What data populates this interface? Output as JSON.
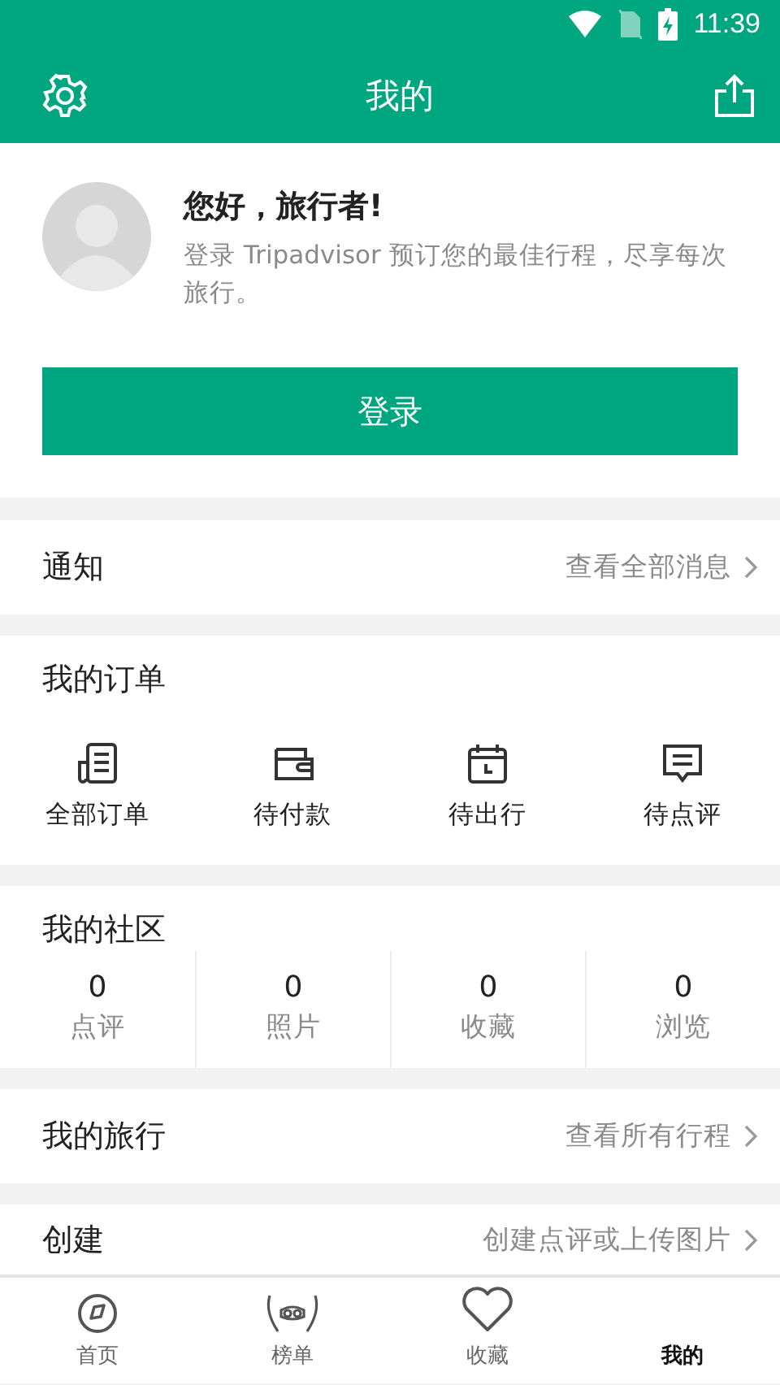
{
  "status_bar": {
    "time": "11:39"
  },
  "header": {
    "title": "我的"
  },
  "profile": {
    "greeting": "您好，旅行者!",
    "description": "登录 Tripadvisor 预订您的最佳行程，尽享每次旅行。",
    "login_button": "登录"
  },
  "notifications": {
    "label": "通知",
    "link": "查看全部消息"
  },
  "orders": {
    "title": "我的订单",
    "items": [
      {
        "kind": "list",
        "label": "全部订单"
      },
      {
        "kind": "wallet",
        "label": "待付款"
      },
      {
        "kind": "calendar",
        "label": "待出行"
      },
      {
        "kind": "comment",
        "label": "待点评"
      }
    ]
  },
  "community": {
    "title": "我的社区",
    "stats": [
      {
        "count": "0",
        "label": "点评"
      },
      {
        "count": "0",
        "label": "照片"
      },
      {
        "count": "0",
        "label": "收藏"
      },
      {
        "count": "0",
        "label": "浏览"
      }
    ]
  },
  "trips": {
    "label": "我的旅行",
    "link": "查看所有行程"
  },
  "create": {
    "label": "创建",
    "link": "创建点评或上传图片"
  },
  "tab_bar": [
    {
      "kind": "compass",
      "label": "首页",
      "selected": false
    },
    {
      "kind": "laurel",
      "label": "榜单",
      "selected": false
    },
    {
      "kind": "heart",
      "label": "收藏",
      "selected": false
    },
    {
      "kind": "none",
      "label": "我的",
      "selected": true
    }
  ]
}
